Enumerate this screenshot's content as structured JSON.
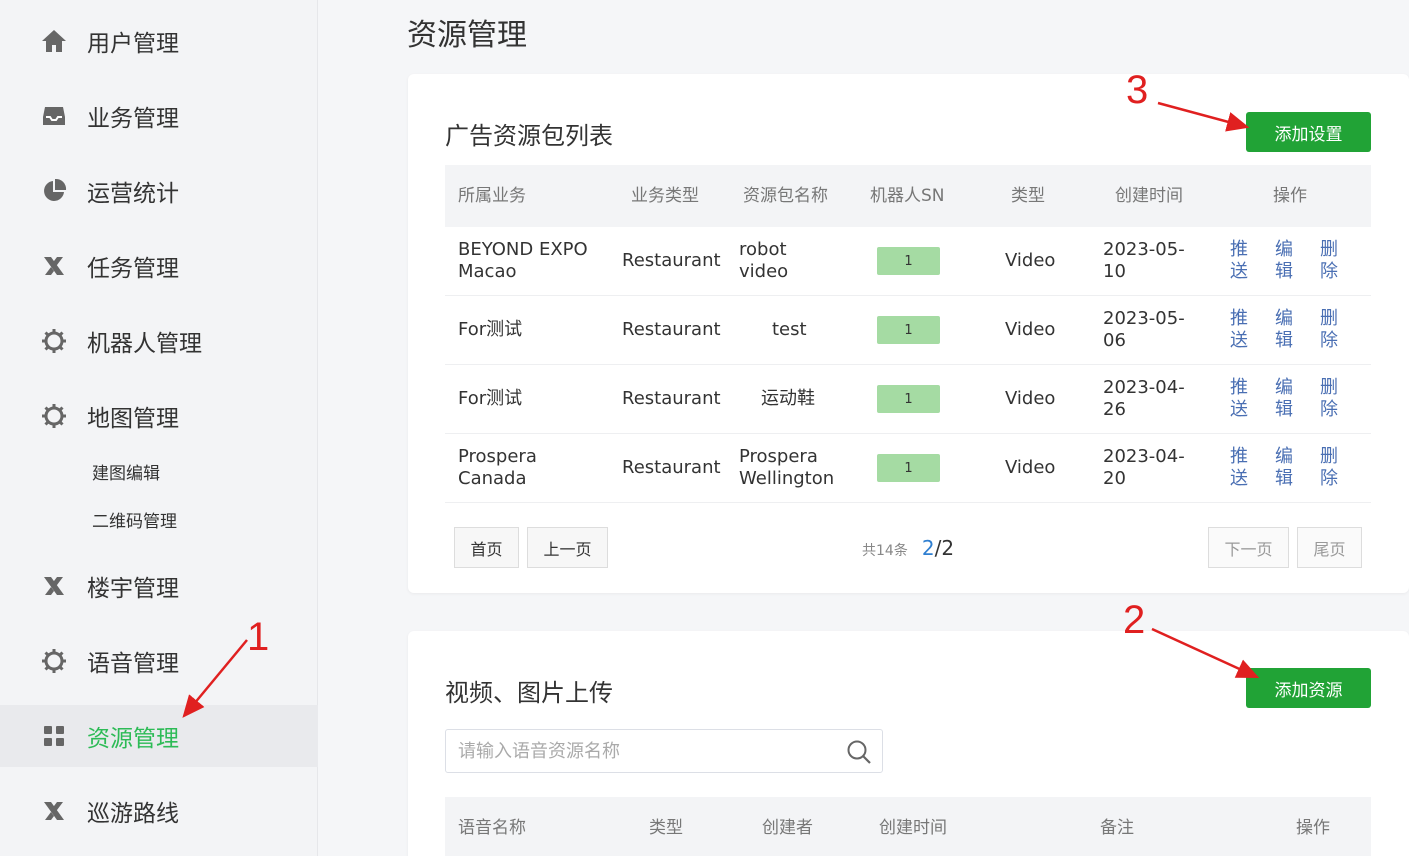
{
  "sidebar": {
    "items": [
      {
        "label": "用户管理",
        "icon": "home-icon"
      },
      {
        "label": "业务管理",
        "icon": "inbox-icon"
      },
      {
        "label": "运营统计",
        "icon": "pie-chart-icon"
      },
      {
        "label": "任务管理",
        "icon": "x-mark-icon"
      },
      {
        "label": "机器人管理",
        "icon": "gear-icon"
      },
      {
        "label": "地图管理",
        "icon": "gear-icon"
      },
      {
        "label": "楼宇管理",
        "icon": "x-mark-icon"
      },
      {
        "label": "语音管理",
        "icon": "gear-icon"
      },
      {
        "label": "资源管理",
        "icon": "grid-icon"
      },
      {
        "label": "巡游路线",
        "icon": "x-mark-icon"
      }
    ],
    "sub_items": [
      "建图编辑",
      "二维码管理"
    ],
    "active_color": "#2dbb56"
  },
  "page": {
    "title": "资源管理"
  },
  "ad_card": {
    "title": "广告资源包列表",
    "add_button": "添加设置",
    "columns": [
      "所属业务",
      "业务类型",
      "资源包名称",
      "机器人SN",
      "类型",
      "创建时间",
      "操作"
    ],
    "rows": [
      {
        "business": "BEYOND EXPO Macao",
        "btype": "Restaurant",
        "package": "robot video",
        "sn": "1",
        "type": "Video",
        "created": "2023-05-10"
      },
      {
        "business": "For测试",
        "btype": "Restaurant",
        "package": "test",
        "sn": "1",
        "type": "Video",
        "created": "2023-05-06"
      },
      {
        "business": "For测试",
        "btype": "Restaurant",
        "package": "运动鞋",
        "sn": "1",
        "type": "Video",
        "created": "2023-04-26"
      },
      {
        "business": "Prospera Canada",
        "btype": "Restaurant",
        "package": "Prospera Wellington",
        "sn": "1",
        "type": "Video",
        "created": "2023-04-20"
      }
    ],
    "ops": {
      "push": "推送",
      "edit": "编辑",
      "delete": "删除"
    },
    "pagination": {
      "first": "首页",
      "prev": "上一页",
      "total": "共14条",
      "current": "2",
      "sep": "/",
      "pages": "2",
      "next": "下一页",
      "last": "尾页"
    }
  },
  "upload_card": {
    "title": "视频、图片上传",
    "add_button": "添加资源",
    "search_placeholder": "请输入语音资源名称",
    "columns": [
      "语音名称",
      "类型",
      "创建者",
      "创建时间",
      "备注",
      "操作"
    ]
  },
  "annotations": {
    "a1": "1",
    "a2": "2",
    "a3": "3",
    "color": "#e02020"
  },
  "colors": {
    "primary_button": "#21a336",
    "badge": "#a5dba3",
    "link": "#4a6fb3"
  }
}
